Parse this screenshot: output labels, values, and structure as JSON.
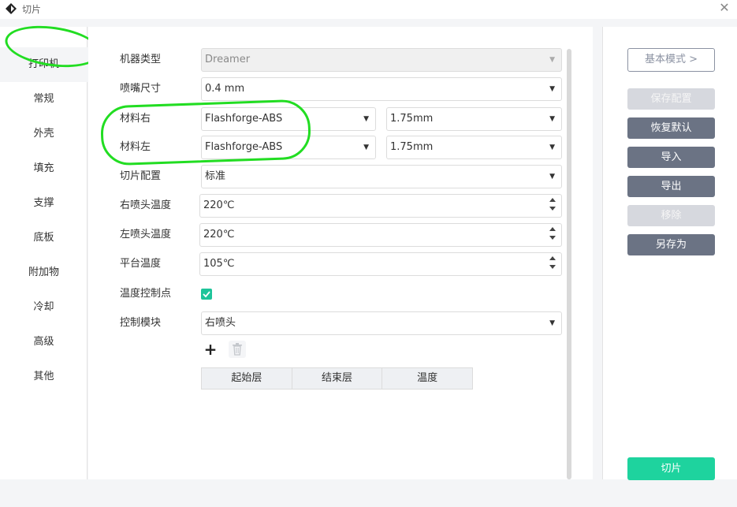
{
  "window": {
    "title": "切片"
  },
  "sidebar": {
    "items": [
      {
        "label": "打印机"
      },
      {
        "label": "常规"
      },
      {
        "label": "外壳"
      },
      {
        "label": "填充"
      },
      {
        "label": "支撑"
      },
      {
        "label": "底板"
      },
      {
        "label": "附加物"
      },
      {
        "label": "冷却"
      },
      {
        "label": "高级"
      },
      {
        "label": "其他"
      }
    ]
  },
  "form": {
    "machine_type": {
      "label": "机器类型",
      "value": "Dreamer"
    },
    "nozzle_size": {
      "label": "喷嘴尺寸",
      "value": "0.4 mm"
    },
    "material_right": {
      "label": "材料右",
      "value": "Flashforge-ABS",
      "diameter": "1.75mm"
    },
    "material_left": {
      "label": "材料左",
      "value": "Flashforge-ABS",
      "diameter": "1.75mm"
    },
    "slice_profile": {
      "label": "切片配置",
      "value": "标准"
    },
    "right_nozzle_temp": {
      "label": "右喷头温度",
      "value": "220℃"
    },
    "left_nozzle_temp": {
      "label": "左喷头温度",
      "value": "220℃"
    },
    "platform_temp": {
      "label": "平台温度",
      "value": "105℃"
    },
    "temp_control_point": {
      "label": "温度控制点",
      "checked": true
    },
    "control_module": {
      "label": "控制模块",
      "value": "右喷头"
    },
    "table": {
      "columns": [
        "起始层",
        "结束层",
        "温度"
      ]
    }
  },
  "actions": {
    "basic_mode": "基本模式 >",
    "save_config": "保存配置",
    "restore_default": "恢复默认",
    "import": "导入",
    "export": "导出",
    "remove": "移除",
    "save_as": "另存为",
    "slice": "切片"
  },
  "colors": {
    "accent": "#1ed39e",
    "button_dark": "#6b7384",
    "button_disabled": "#d6d8de",
    "highlight": "#22dd22"
  }
}
